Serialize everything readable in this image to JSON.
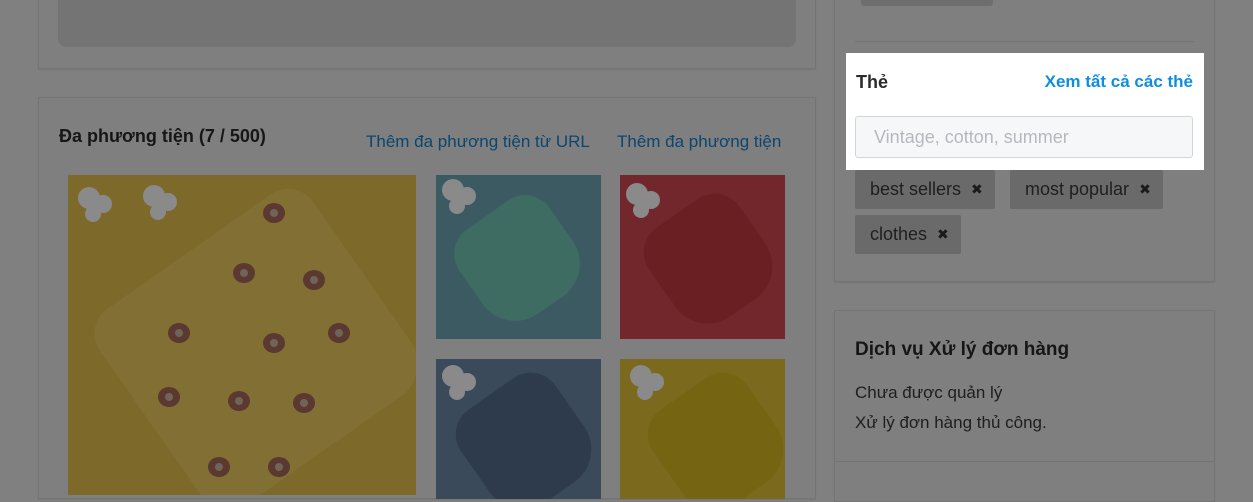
{
  "media": {
    "title": "Đa phương tiện (7 / 500)",
    "add_from_url": "Thêm đa phương tiện từ URL",
    "add_media": "Thêm đa phương tiện"
  },
  "tags": {
    "title": "Thẻ",
    "view_all": "Xem tất cả các thẻ",
    "input_placeholder": "Vintage, cotton, summer",
    "items": [
      {
        "label": "best sellers",
        "remove": "✖"
      },
      {
        "label": "most popular",
        "remove": "✖"
      },
      {
        "label": "clothes",
        "remove": "✖"
      }
    ]
  },
  "fulfillment": {
    "title": "Dịch vụ Xử lý đơn hàng",
    "status": "Chưa được quản lý",
    "note": "Xử lý đơn hàng thủ công."
  },
  "colors": {
    "overlay": "#808080",
    "link": "#0e8ee0",
    "highlight_bg": "#ffffff"
  }
}
